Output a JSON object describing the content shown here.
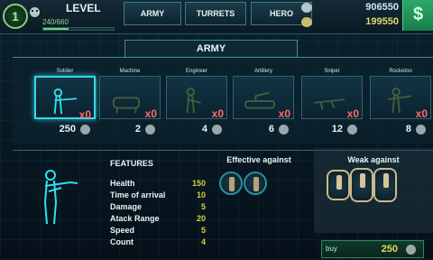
{
  "player": {
    "level": "1",
    "level_label": "LEVEL",
    "xp_text": "240/660",
    "xp_progress": 0.364
  },
  "tabs": [
    {
      "label": "ARMY",
      "active": true
    },
    {
      "label": "TURRETS",
      "active": false
    },
    {
      "label": "HERO",
      "active": false
    }
  ],
  "resources": {
    "primary": "906550",
    "secondary": "199550",
    "shop_icon": "dollar-icon"
  },
  "army": {
    "title": "ARMY",
    "units": [
      {
        "name": "Soldier",
        "count": "x0",
        "cost": "250",
        "selected": true
      },
      {
        "name": "Machine",
        "count": "x0",
        "cost": "2",
        "selected": false
      },
      {
        "name": "Engineer",
        "count": "x0",
        "cost": "4",
        "selected": false
      },
      {
        "name": "Artillery",
        "count": "x0",
        "cost": "6",
        "selected": false
      },
      {
        "name": "Sniper",
        "count": "x0",
        "cost": "12",
        "selected": false
      },
      {
        "name": "Rocketoo",
        "count": "x0",
        "cost": "8",
        "selected": false
      }
    ]
  },
  "features": {
    "title": "FEATURES",
    "stats": [
      {
        "label": "Health",
        "value": "150"
      },
      {
        "label": "Time of arrival",
        "value": "10"
      },
      {
        "label": "Damage",
        "value": "5"
      },
      {
        "label": "Atack Range",
        "value": "20"
      },
      {
        "label": "Speed",
        "value": "5"
      },
      {
        "label": "Count",
        "value": "4"
      }
    ]
  },
  "effective": {
    "title": "Effective against"
  },
  "weak": {
    "title": "Weak against"
  },
  "buy": {
    "label": "buy",
    "price": "250"
  },
  "colors": {
    "accent": "#3ad6e8",
    "stat_value": "#d8cf3c",
    "count": "#ff6b6b",
    "shop": "#2ea86a"
  }
}
